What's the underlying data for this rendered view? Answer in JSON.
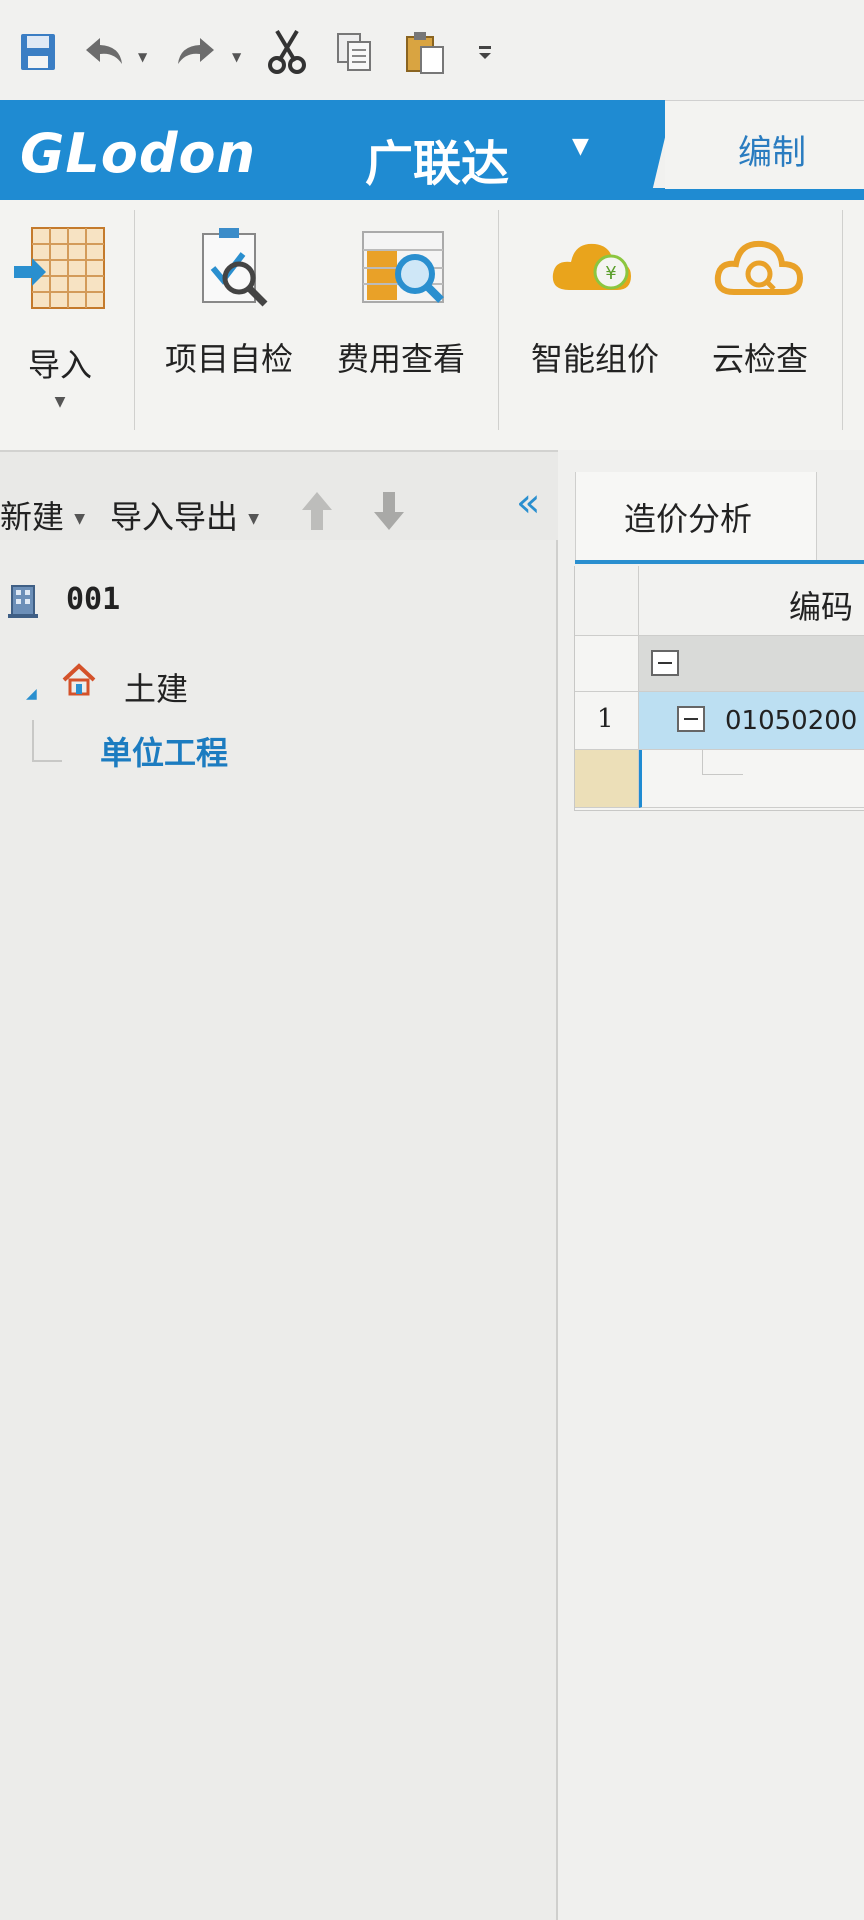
{
  "quick_access": {
    "icons": [
      "save-icon",
      "undo-icon",
      "redo-icon",
      "cut-icon",
      "copy-icon",
      "paste-icon",
      "customize-icon"
    ]
  },
  "brand": {
    "logo_text": "GLodon",
    "logo_cn": "广联达",
    "tab_label": "编制",
    "accent_color": "#1f8bd2"
  },
  "ribbon": {
    "buttons": [
      {
        "label": "导入",
        "icon": "import-table-icon"
      },
      {
        "label": "项目自检",
        "icon": "project-check-icon"
      },
      {
        "label": "费用查看",
        "icon": "cost-view-icon"
      },
      {
        "label": "智能组价",
        "icon": "smart-pricing-icon"
      },
      {
        "label": "云检查",
        "icon": "cloud-check-icon"
      }
    ]
  },
  "left_toolbar": {
    "new_label": "新建",
    "import_export_label": "导入导出"
  },
  "tree": {
    "root": "001",
    "child": "土建",
    "leaf": "单位工程"
  },
  "right": {
    "tab_label": "造价分析",
    "grid": {
      "header_code": "编码",
      "row_number": "1",
      "row_code": "01050200"
    }
  }
}
